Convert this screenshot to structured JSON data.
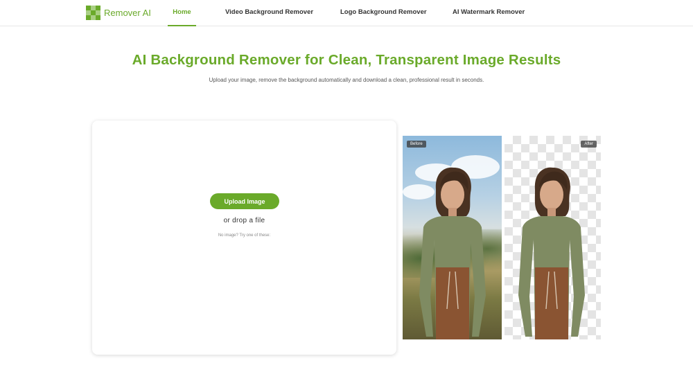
{
  "header": {
    "brand": "Remover AI",
    "logo_icon": "checkerboard-logo-icon",
    "nav": [
      {
        "label": "Home",
        "active": true
      },
      {
        "label": "Video Background Remover",
        "active": false
      },
      {
        "label": "Logo Background Remover",
        "active": false
      },
      {
        "label": "AI Watermark Remover",
        "active": false
      }
    ]
  },
  "hero": {
    "title": "AI Background Remover for Clean, Transparent Image Results",
    "subtitle": "Upload your image, remove the background automatically and download a clean, professional result in seconds."
  },
  "upload": {
    "button_label": "Upload Image",
    "drop_text": "or drop a file",
    "sample_text": "No image? Try one of these:"
  },
  "preview": {
    "before_label": "Before",
    "after_label": "After"
  },
  "colors": {
    "accent": "#6aaa2a",
    "text": "#333333"
  }
}
